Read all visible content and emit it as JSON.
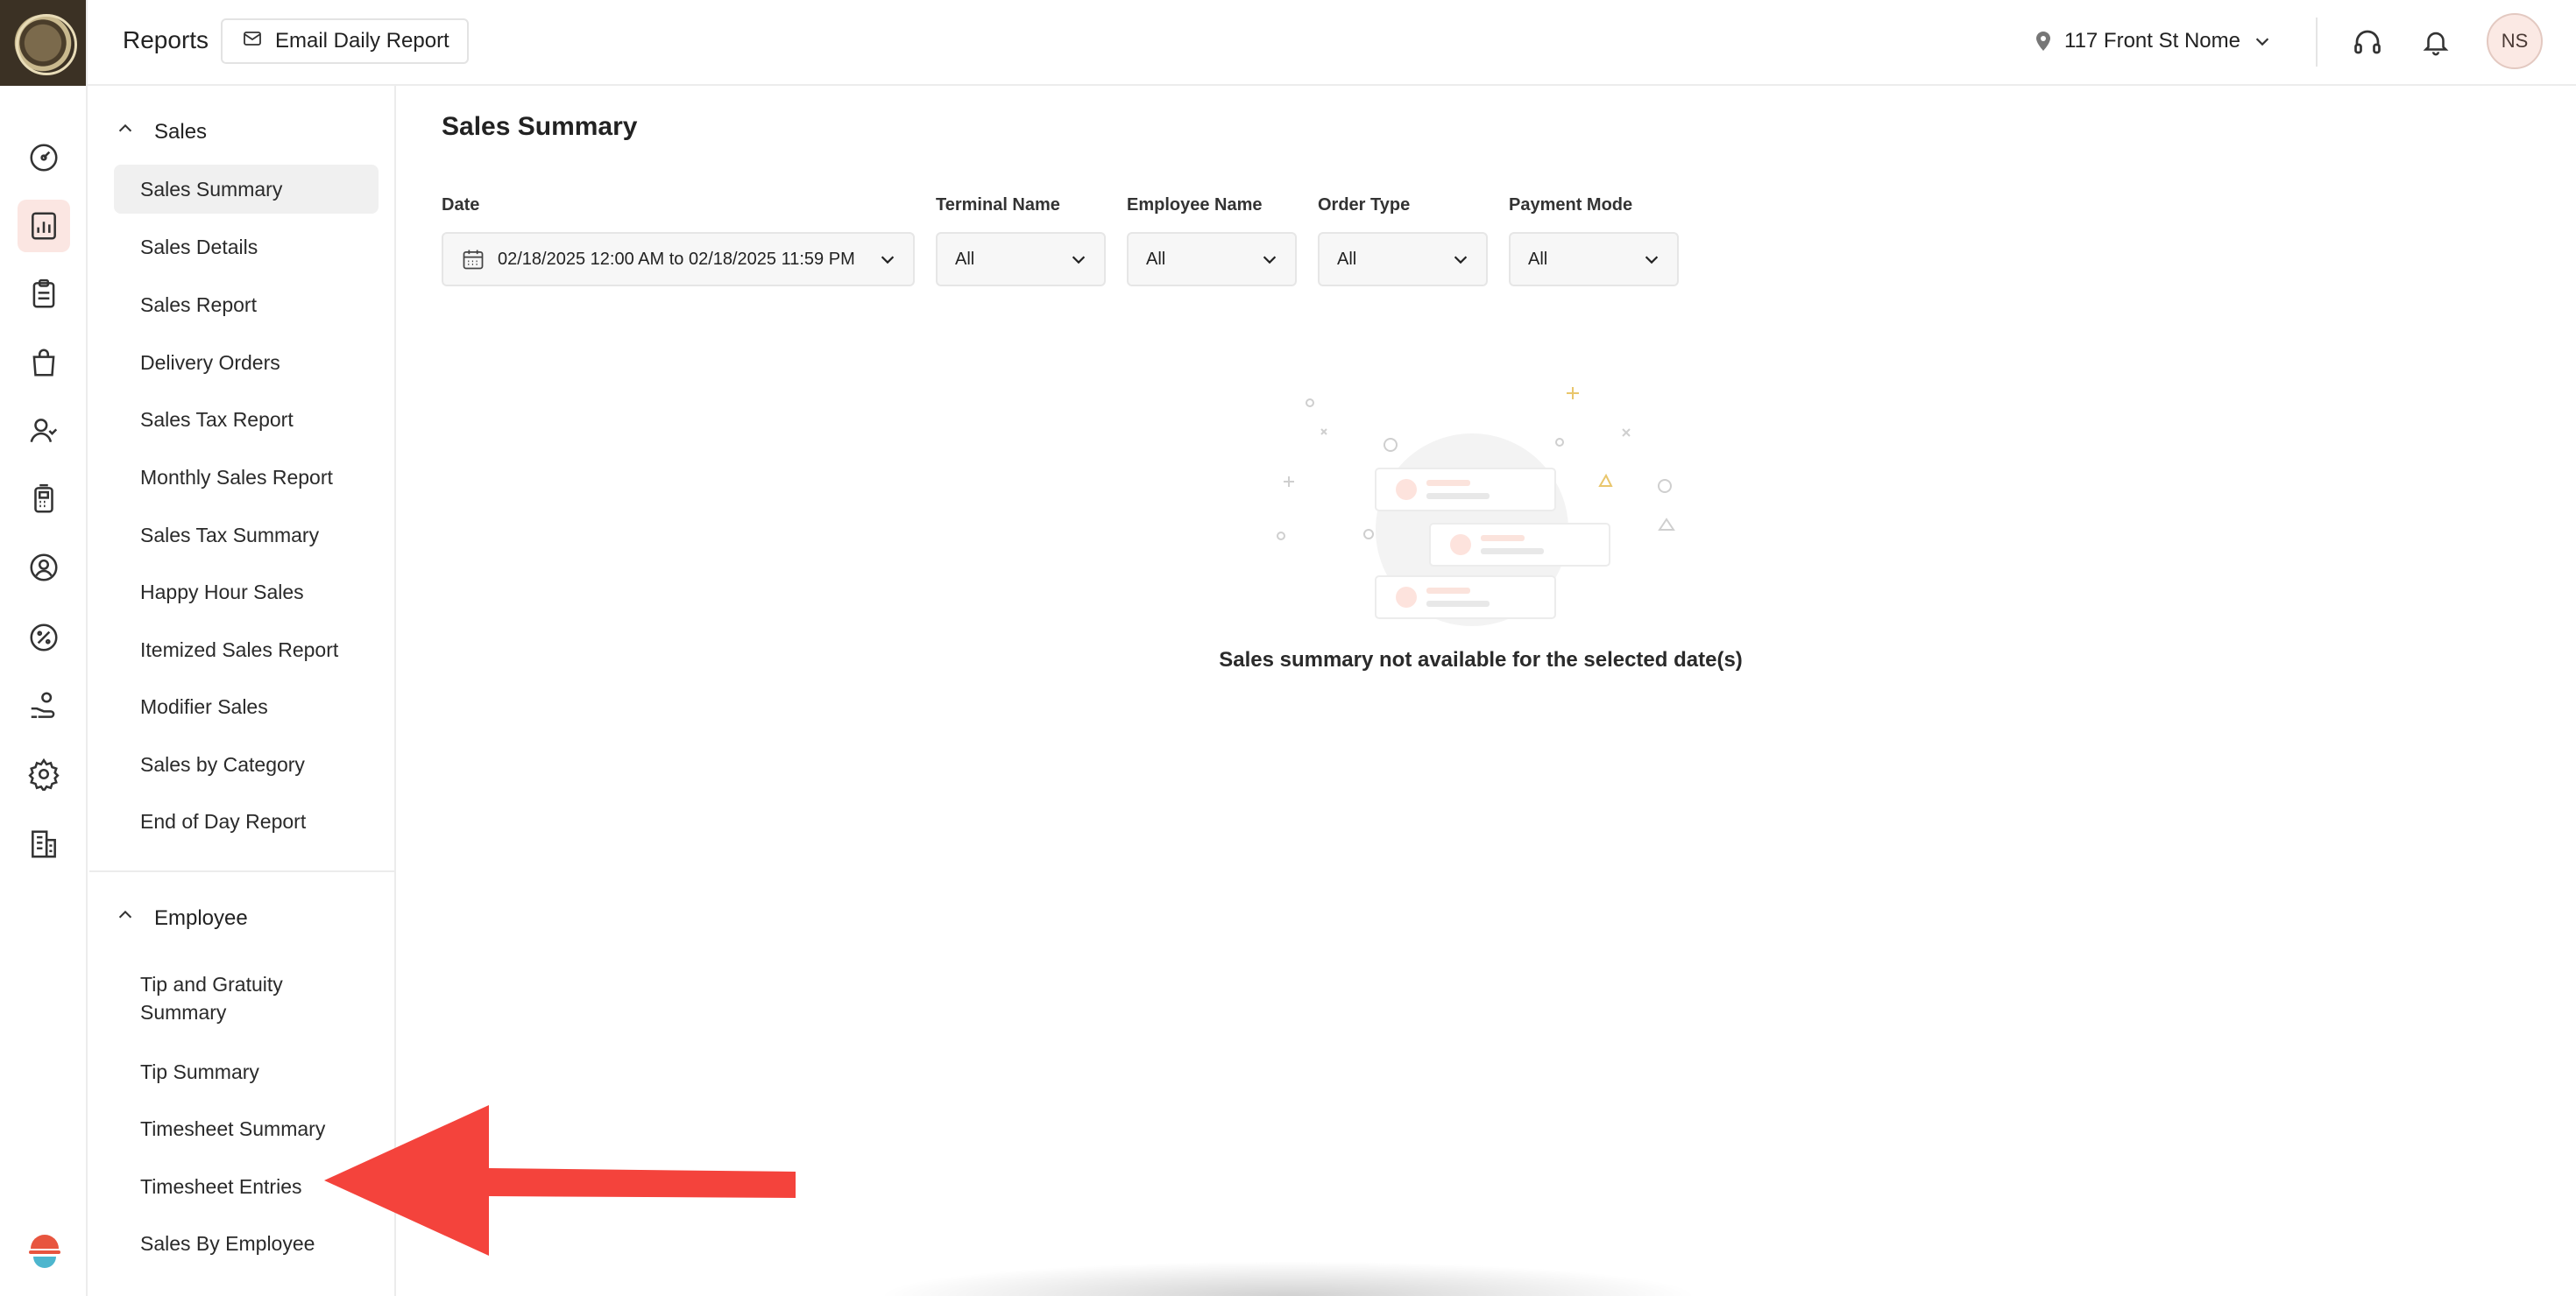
{
  "header": {
    "title": "Reports",
    "email_button": "Email Daily Report",
    "location": "117 Front St Nome",
    "avatar_initials": "NS"
  },
  "rail": {
    "items": [
      "dashboard-icon",
      "reports-icon",
      "orders-icon",
      "shopping-bag-icon",
      "customers-icon",
      "terminal-icon",
      "user-icon",
      "discount-icon",
      "payroll-icon",
      "settings-icon",
      "business-icon"
    ],
    "active": "reports-icon"
  },
  "subnav": {
    "sales": {
      "heading": "Sales",
      "items": [
        "Sales Summary",
        "Sales Details",
        "Sales Report",
        "Delivery Orders",
        "Sales Tax Report",
        "Monthly Sales Report",
        "Sales Tax Summary",
        "Happy Hour Sales",
        "Itemized Sales Report",
        "Modifier Sales",
        "Sales by Category",
        "End of Day Report"
      ],
      "active": "Sales Summary"
    },
    "employee": {
      "heading": "Employee",
      "items": [
        "Tip and Gratuity Summary",
        "Tip Summary",
        "Timesheet Summary",
        "Timesheet Entries",
        "Sales By Employee"
      ]
    }
  },
  "main": {
    "title": "Sales Summary",
    "filters": {
      "date": {
        "label": "Date",
        "value": "02/18/2025 12:00 AM to 02/18/2025 11:59 PM"
      },
      "terminal": {
        "label": "Terminal Name",
        "value": "All"
      },
      "employee": {
        "label": "Employee Name",
        "value": "All"
      },
      "order_type": {
        "label": "Order Type",
        "value": "All"
      },
      "payment_mode": {
        "label": "Payment Mode",
        "value": "All"
      }
    },
    "empty_message": "Sales summary not available for the selected date(s)"
  },
  "colors": {
    "accent": "#e8553f",
    "active_rail_bg": "#fbe6e2",
    "annotation_arrow": "#f4433c"
  }
}
